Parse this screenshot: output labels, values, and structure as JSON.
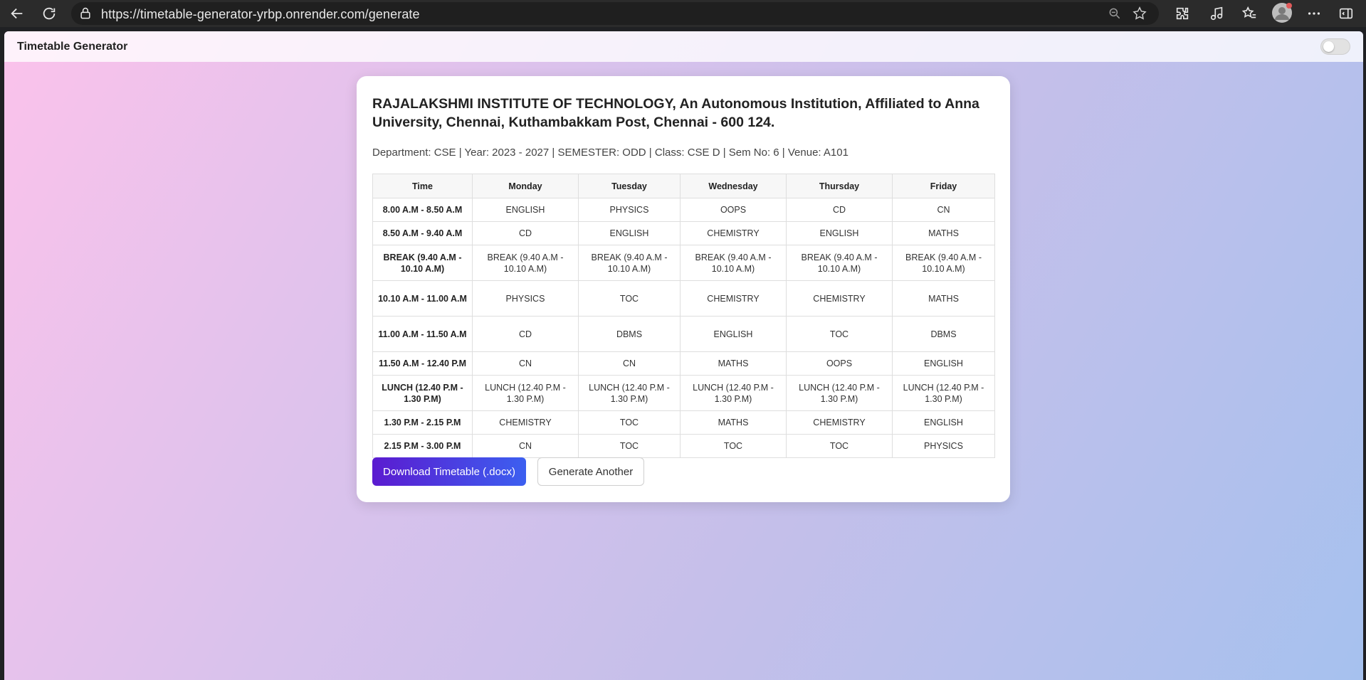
{
  "browser": {
    "url": "https://timetable-generator-yrbp.onrender.com/generate"
  },
  "app": {
    "title": "Timetable Generator"
  },
  "card": {
    "institution": "RAJALAKSHMI INSTITUTE OF TECHNOLOGY, An Autonomous Institution, Affiliated to Anna University, Chennai, Kuthambakkam Post, Chennai - 600 124.",
    "meta": "Department: CSE | Year: 2023 - 2027 | SEMESTER: ODD | Class: CSE D | Sem No: 6 | Venue: A101"
  },
  "table": {
    "headers": [
      "Time",
      "Monday",
      "Tuesday",
      "Wednesday",
      "Thursday",
      "Friday"
    ],
    "rows": [
      [
        "8.00 A.M - 8.50 A.M",
        "ENGLISH",
        "PHYSICS",
        "OOPS",
        "CD",
        "CN"
      ],
      [
        "8.50 A.M - 9.40 A.M",
        "CD",
        "ENGLISH",
        "CHEMISTRY",
        "ENGLISH",
        "MATHS"
      ],
      [
        "BREAK (9.40 A.M - 10.10 A.M)",
        "BREAK (9.40 A.M - 10.10 A.M)",
        "BREAK (9.40 A.M - 10.10 A.M)",
        "BREAK (9.40 A.M - 10.10 A.M)",
        "BREAK (9.40 A.M - 10.10 A.M)",
        "BREAK (9.40 A.M - 10.10 A.M)"
      ],
      [
        "10.10 A.M - 11.00 A.M",
        "PHYSICS",
        "TOC",
        "CHEMISTRY",
        "CHEMISTRY",
        "MATHS"
      ],
      [
        "11.00 A.M - 11.50 A.M",
        "CD",
        "DBMS",
        "ENGLISH",
        "TOC",
        "DBMS"
      ],
      [
        "11.50 A.M - 12.40 P.M",
        "CN",
        "CN",
        "MATHS",
        "OOPS",
        "ENGLISH"
      ],
      [
        "LUNCH (12.40 P.M - 1.30 P.M)",
        "LUNCH (12.40 P.M - 1.30 P.M)",
        "LUNCH (12.40 P.M - 1.30 P.M)",
        "LUNCH (12.40 P.M - 1.30 P.M)",
        "LUNCH (12.40 P.M - 1.30 P.M)",
        "LUNCH (12.40 P.M - 1.30 P.M)"
      ],
      [
        "1.30 P.M - 2.15 P.M",
        "CHEMISTRY",
        "TOC",
        "MATHS",
        "CHEMISTRY",
        "ENGLISH"
      ],
      [
        "2.15 P.M - 3.00 P.M",
        "CN",
        "TOC",
        "TOC",
        "TOC",
        "PHYSICS"
      ]
    ]
  },
  "buttons": {
    "download": "Download Timetable (.docx)",
    "another": "Generate Another"
  },
  "colors": {
    "accent_start": "#5b1bd0",
    "accent_end": "#3c5ff0"
  }
}
